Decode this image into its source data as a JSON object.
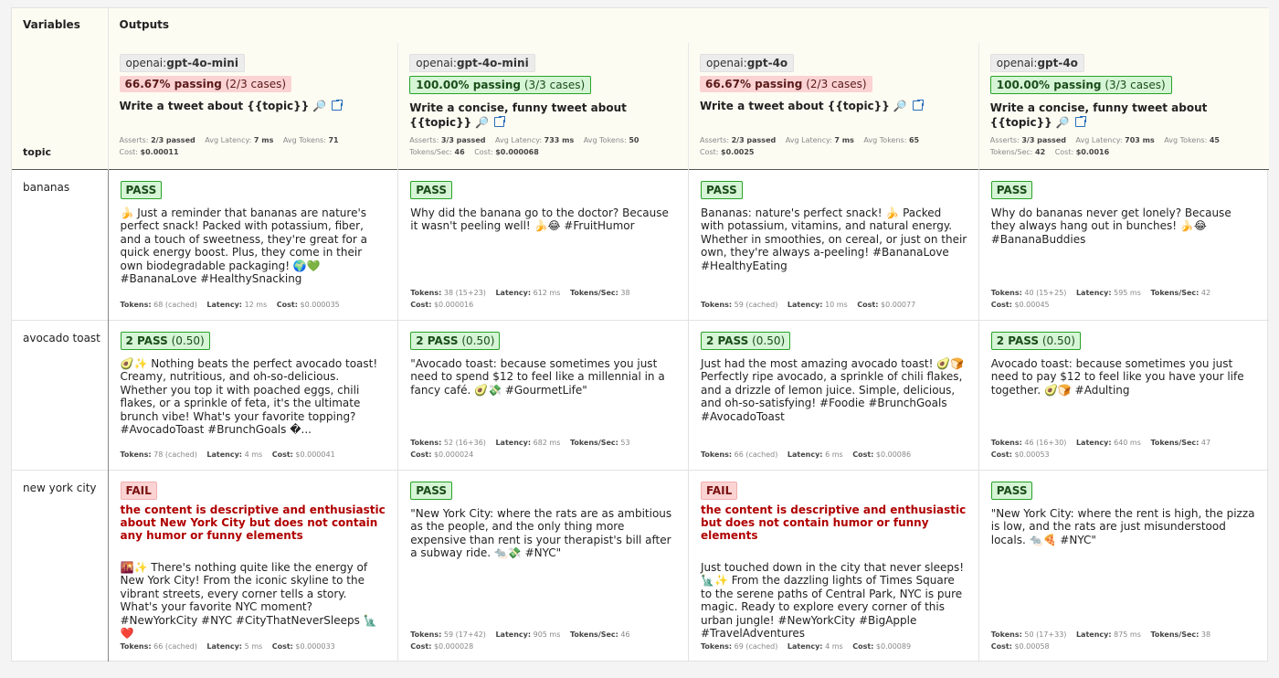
{
  "header": {
    "variables_label": "Variables",
    "outputs_label": "Outputs",
    "topic_label": "topic"
  },
  "providers": [
    {
      "provider_prefix": "openai:",
      "provider_model": "gpt-4o-mini",
      "pass_pct": "66.67% passing",
      "pass_cases": "(2/3 cases)",
      "pass_status": "partial",
      "prompt": "Write a tweet about {{topic}}",
      "stats": {
        "asserts_label": "Asserts:",
        "asserts": "2/3 passed",
        "latency_label": "Avg Latency:",
        "latency": "7 ms",
        "tokens_label": "Avg Tokens:",
        "tokens": "71",
        "tps_label": "",
        "tps": "",
        "cost_label": "Cost:",
        "cost": "$0.00011"
      }
    },
    {
      "provider_prefix": "openai:",
      "provider_model": "gpt-4o-mini",
      "pass_pct": "100.00% passing",
      "pass_cases": "(3/3 cases)",
      "pass_status": "full",
      "prompt": "Write a concise, funny tweet about {{topic}}",
      "stats": {
        "asserts_label": "Asserts:",
        "asserts": "3/3 passed",
        "latency_label": "Avg Latency:",
        "latency": "733 ms",
        "tokens_label": "Avg Tokens:",
        "tokens": "50",
        "tps_label": "Tokens/Sec:",
        "tps": "46",
        "cost_label": "Cost:",
        "cost": "$0.000068"
      }
    },
    {
      "provider_prefix": "openai:",
      "provider_model": "gpt-4o",
      "pass_pct": "66.67% passing",
      "pass_cases": "(2/3 cases)",
      "pass_status": "partial",
      "prompt": "Write a tweet about {{topic}}",
      "stats": {
        "asserts_label": "Asserts:",
        "asserts": "2/3 passed",
        "latency_label": "Avg Latency:",
        "latency": "7 ms",
        "tokens_label": "Avg Tokens:",
        "tokens": "65",
        "tps_label": "",
        "tps": "",
        "cost_label": "Cost:",
        "cost": "$0.0025"
      }
    },
    {
      "provider_prefix": "openai:",
      "provider_model": "gpt-4o",
      "pass_pct": "100.00% passing",
      "pass_cases": "(3/3 cases)",
      "pass_status": "full",
      "prompt": "Write a concise, funny tweet about {{topic}}",
      "stats": {
        "asserts_label": "Asserts:",
        "asserts": "3/3 passed",
        "latency_label": "Avg Latency:",
        "latency": "703 ms",
        "tokens_label": "Avg Tokens:",
        "tokens": "45",
        "tps_label": "Tokens/Sec:",
        "tps": "42",
        "cost_label": "Cost:",
        "cost": "$0.0016"
      }
    }
  ],
  "rows": [
    {
      "topic": "bananas",
      "cells": [
        {
          "status": "pass",
          "badge_main": "PASS",
          "badge_extra": "",
          "reason": "",
          "text": "🍌 Just a reminder that bananas are nature's perfect snack! Packed with potassium, fiber, and a touch of sweetness, they're great for a quick energy boost. Plus, they come in their own biodegradable packaging! 🌍💚 #BananaLove #HealthySnacking",
          "tokens": "68 (cached)",
          "latency": "12 ms",
          "tps": "",
          "cost": "$0.000035"
        },
        {
          "status": "pass",
          "badge_main": "PASS",
          "badge_extra": "",
          "reason": "",
          "text": "Why did the banana go to the doctor? Because it wasn't peeling well! 🍌😂 #FruitHumor",
          "tokens": "38 (15+23)",
          "latency": "612 ms",
          "tps": "38",
          "cost": "$0.000016"
        },
        {
          "status": "pass",
          "badge_main": "PASS",
          "badge_extra": "",
          "reason": "",
          "text": "Bananas: nature's perfect snack! 🍌 Packed with potassium, vitamins, and natural energy. Whether in smoothies, on cereal, or just on their own, they're always a-peeling! #BananaLove #HealthyEating",
          "tokens": "59 (cached)",
          "latency": "10 ms",
          "tps": "",
          "cost": "$0.00077"
        },
        {
          "status": "pass",
          "badge_main": "PASS",
          "badge_extra": "",
          "reason": "",
          "text": "Why do bananas never get lonely? Because they always hang out in bunches! 🍌😂 #BananaBuddies",
          "tokens": "40 (15+25)",
          "latency": "595 ms",
          "tps": "42",
          "cost": "$0.00045"
        }
      ]
    },
    {
      "topic": "avocado toast",
      "cells": [
        {
          "status": "pass",
          "badge_main": "2 PASS",
          "badge_extra": "(0.50)",
          "reason": "",
          "text": "🥑✨ Nothing beats the perfect avocado toast! Creamy, nutritious, and oh-so-delicious. Whether you top it with poached eggs, chili flakes, or a sprinkle of feta, it's the ultimate brunch vibe! What's your favorite topping? #AvocadoToast #BrunchGoals �...",
          "tokens": "78 (cached)",
          "latency": "4 ms",
          "tps": "",
          "cost": "$0.000041"
        },
        {
          "status": "pass",
          "badge_main": "2 PASS",
          "badge_extra": "(0.50)",
          "reason": "",
          "text": "\"Avocado toast: because sometimes you just need to spend $12 to feel like a millennial in a fancy café. 🥑💸 #GourmetLife\"",
          "tokens": "52 (16+36)",
          "latency": "682 ms",
          "tps": "53",
          "cost": "$0.000024"
        },
        {
          "status": "pass",
          "badge_main": "2 PASS",
          "badge_extra": "(0.50)",
          "reason": "",
          "text": "Just had the most amazing avocado toast! 🥑🍞 Perfectly ripe avocado, a sprinkle of chili flakes, and a drizzle of lemon juice. Simple, delicious, and oh-so-satisfying! #Foodie #BrunchGoals #AvocadoToast",
          "tokens": "66 (cached)",
          "latency": "6 ms",
          "tps": "",
          "cost": "$0.00086"
        },
        {
          "status": "pass",
          "badge_main": "2 PASS",
          "badge_extra": "(0.50)",
          "reason": "",
          "text": "Avocado toast: because sometimes you just need to pay $12 to feel like you have your life together. 🥑🍞 #Adulting",
          "tokens": "46 (16+30)",
          "latency": "640 ms",
          "tps": "47",
          "cost": "$0.00053"
        }
      ]
    },
    {
      "topic": "new york city",
      "cells": [
        {
          "status": "fail",
          "badge_main": "FAIL",
          "badge_extra": "",
          "reason": "the content is descriptive and enthusiastic about New York City but does not contain any humor or funny elements",
          "text": "🌇✨ There's nothing quite like the energy of New York City! From the iconic skyline to the vibrant streets, every corner tells a story. What's your favorite NYC moment? #NewYorkCity #NYC #CityThatNeverSleeps 🗽❤️",
          "tokens": "66 (cached)",
          "latency": "5 ms",
          "tps": "",
          "cost": "$0.000033"
        },
        {
          "status": "pass",
          "badge_main": "PASS",
          "badge_extra": "",
          "reason": "",
          "text": "\"New York City: where the rats are as ambitious as the people, and the only thing more expensive than rent is your therapist's bill after a subway ride. 🐀💸 #NYC\"",
          "tokens": "59 (17+42)",
          "latency": "905 ms",
          "tps": "46",
          "cost": "$0.000028"
        },
        {
          "status": "fail",
          "badge_main": "FAIL",
          "badge_extra": "",
          "reason": "the content is descriptive and enthusiastic but does not contain humor or funny elements",
          "text": "Just touched down in the city that never sleeps! 🗽✨ From the dazzling lights of Times Square to the serene paths of Central Park, NYC is pure magic. Ready to explore every corner of this urban jungle! #NewYorkCity #BigApple #TravelAdventures",
          "tokens": "69 (cached)",
          "latency": "4 ms",
          "tps": "",
          "cost": "$0.00089"
        },
        {
          "status": "pass",
          "badge_main": "PASS",
          "badge_extra": "",
          "reason": "",
          "text": "\"New York City: where the rent is high, the pizza is low, and the rats are just misunderstood locals. 🐀🍕 #NYC\"",
          "tokens": "50 (17+33)",
          "latency": "875 ms",
          "tps": "38",
          "cost": "$0.00058"
        }
      ]
    }
  ],
  "labels": {
    "tokens": "Tokens:",
    "latency": "Latency:",
    "tps": "Tokens/Sec:",
    "cost": "Cost:"
  },
  "icons": {
    "magnifier": "🔎",
    "external_link": "external-link-icon"
  },
  "colors": {
    "pass_bg": "#d6f5d6",
    "pass_border": "#27a327",
    "fail_bg": "#fbd3d3",
    "fail_text": "#b00000",
    "header_bg": "#fdfcf3",
    "link": "#2a6ebb"
  }
}
